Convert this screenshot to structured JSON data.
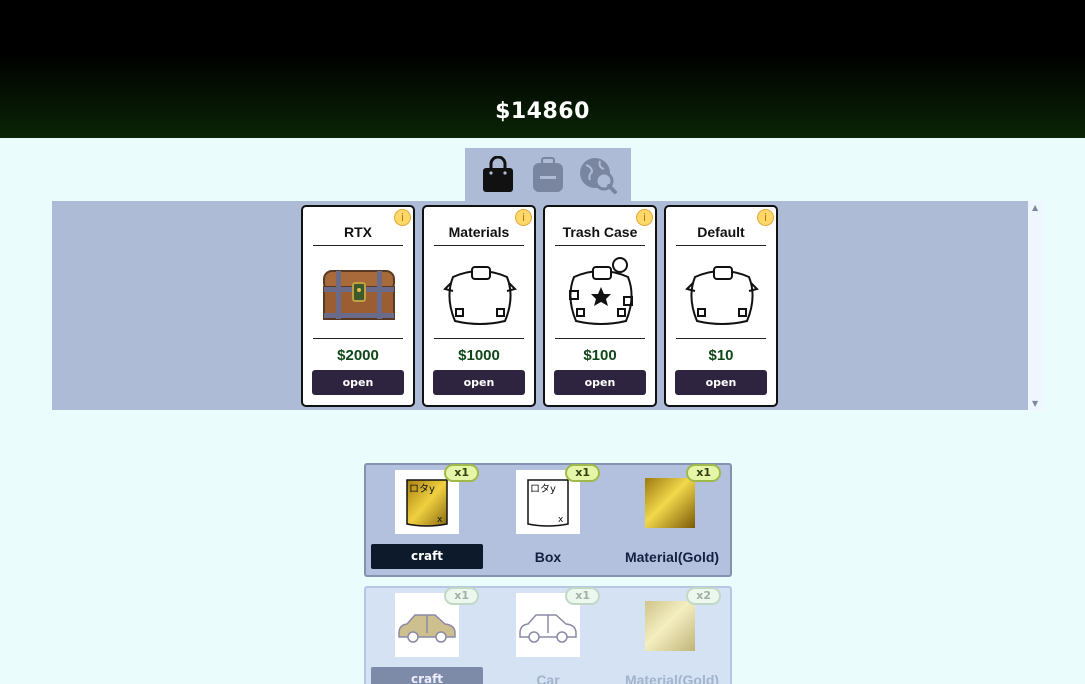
{
  "header": {
    "money": "$14860"
  },
  "tabs": [
    {
      "name": "shop",
      "icon": "shopping-bag-icon",
      "active": true
    },
    {
      "name": "inventory",
      "icon": "backpack-icon",
      "active": false
    },
    {
      "name": "explore",
      "icon": "globe-search-icon",
      "active": false
    }
  ],
  "cases": [
    {
      "title": "RTX",
      "price": "$2000",
      "open_label": "open",
      "info": "i",
      "image": "treasure-chest-icon"
    },
    {
      "title": "Materials",
      "price": "$1000",
      "open_label": "open",
      "info": "i",
      "image": "sack-icon"
    },
    {
      "title": "Trash Case",
      "price": "$100",
      "open_label": "open",
      "info": "i",
      "image": "trash-sack-icon"
    },
    {
      "title": "Default",
      "price": "$10",
      "open_label": "open",
      "info": "i",
      "image": "sack-icon"
    }
  ],
  "recipes": [
    {
      "craft_label": "craft",
      "slots": [
        {
          "label": "",
          "qty": "x1",
          "image": "gold-box-scroll-icon"
        },
        {
          "label": "Box",
          "qty": "x1",
          "image": "box-scroll-icon"
        },
        {
          "label": "Material(Gold)",
          "qty": "x1",
          "image": "gold-material-icon"
        }
      ]
    },
    {
      "craft_label": "craft",
      "slots": [
        {
          "label": "",
          "qty": "x1",
          "image": "gold-car-icon"
        },
        {
          "label": "Car",
          "qty": "x1",
          "image": "car-icon"
        },
        {
          "label": "Material(Gold)",
          "qty": "x2",
          "image": "gold-material-icon"
        }
      ]
    }
  ],
  "colors": {
    "accent_dark": "#2f2440",
    "price_green": "#0f4718",
    "panel": "#aebbd7",
    "background": "#eafcfc"
  }
}
